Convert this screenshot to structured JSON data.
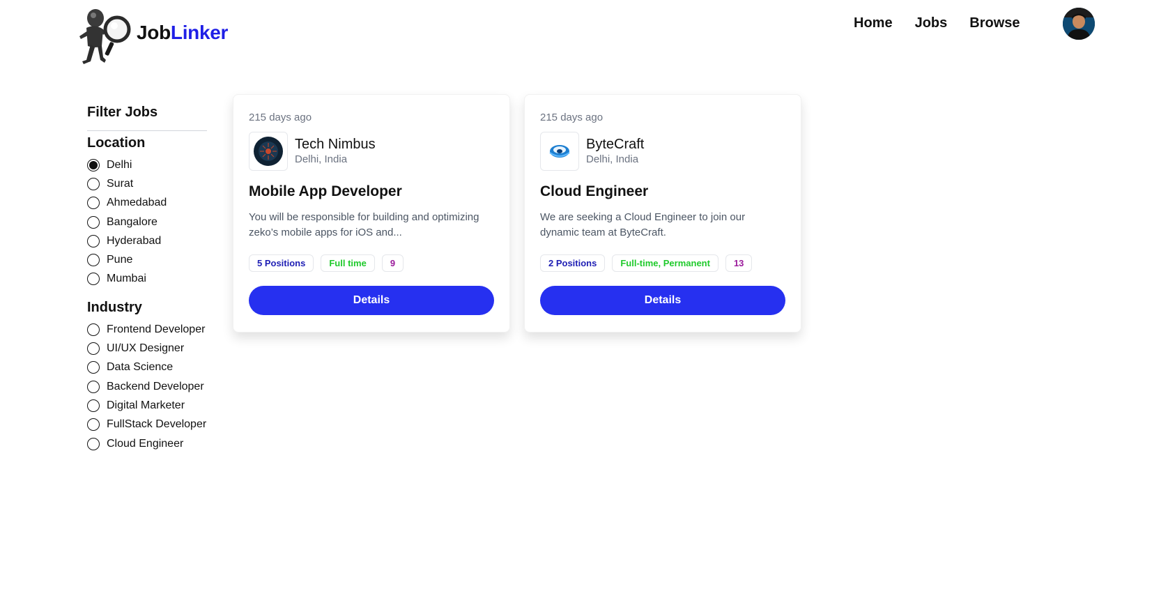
{
  "brand": {
    "prefix": "Job",
    "suffix": "Linker",
    "accent_color": "#1f1fe6"
  },
  "nav": {
    "items": [
      {
        "label": "Home"
      },
      {
        "label": "Jobs"
      },
      {
        "label": "Browse"
      }
    ]
  },
  "sidebar": {
    "title": "Filter Jobs",
    "groups": [
      {
        "title": "Location",
        "options": [
          "Delhi",
          "Surat",
          "Ahmedabad",
          "Bangalore",
          "Hyderabad",
          "Pune",
          "Mumbai"
        ],
        "selected": "Delhi"
      },
      {
        "title": "Industry",
        "options": [
          "Frontend Developer",
          "UI/UX Designer",
          "Data Science",
          "Backend Developer",
          "Digital Marketer",
          "FullStack Developer",
          "Cloud Engineer"
        ],
        "selected": null
      }
    ]
  },
  "jobs": [
    {
      "posted": "215 days ago",
      "company": "Tech Nimbus",
      "location": "Delhi, India",
      "title": "Mobile App Developer",
      "description": "You will be responsible for building and optimizing zeko’s mobile apps for iOS and...",
      "positions": "5 Positions",
      "job_type": "Full time",
      "salary": "9",
      "button": "Details"
    },
    {
      "posted": "215 days ago",
      "company": "ByteCraft",
      "location": "Delhi, India",
      "title": "Cloud Engineer",
      "description": "We are seeking a Cloud Engineer to join our dynamic team at ByteCraft.",
      "positions": "2 Positions",
      "job_type": "Full-time, Permanent",
      "salary": "13",
      "button": "Details"
    }
  ],
  "colors": {
    "primary_button": "#2630f0",
    "badge_blue": "#1e1eb4",
    "badge_green": "#1fca2b",
    "badge_purple": "#9b1b9b"
  }
}
